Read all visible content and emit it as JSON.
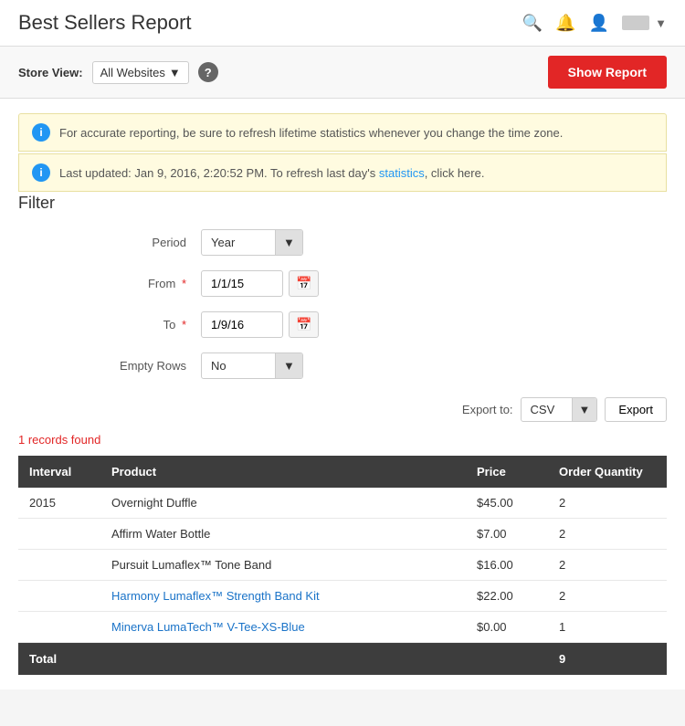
{
  "header": {
    "title": "Best Sellers Report",
    "icons": {
      "search": "&#128269;",
      "bell": "&#128276;",
      "user": "&#128100;"
    }
  },
  "storeViewBar": {
    "label": "Store View:",
    "selected": "All Websites",
    "helpTooltip": "?",
    "showReportBtn": "Show Report"
  },
  "infoBanners": [
    {
      "id": "banner1",
      "text": "For accurate reporting, be sure to refresh lifetime statistics whenever you change the time zone."
    },
    {
      "id": "banner2",
      "textBefore": "Last updated: Jan 9, 2016, 2:20:52 PM. To refresh last day's ",
      "linkText": "statistics",
      "textAfter": ", click here."
    }
  ],
  "filter": {
    "title": "Filter",
    "fields": {
      "period": {
        "label": "Period",
        "value": "Year"
      },
      "from": {
        "label": "From",
        "required": true,
        "value": "1/1/15"
      },
      "to": {
        "label": "To",
        "required": true,
        "value": "1/9/16"
      },
      "emptyRows": {
        "label": "Empty Rows",
        "value": "No"
      }
    }
  },
  "export": {
    "label": "Export to:",
    "format": "CSV",
    "btnLabel": "Export"
  },
  "recordsFound": "1 records found",
  "table": {
    "columns": [
      {
        "id": "interval",
        "label": "Interval"
      },
      {
        "id": "product",
        "label": "Product"
      },
      {
        "id": "price",
        "label": "Price"
      },
      {
        "id": "qty",
        "label": "Order Quantity"
      }
    ],
    "rows": [
      {
        "interval": "2015",
        "product": "Overnight Duffle",
        "price": "$45.00",
        "qty": "2",
        "link": false
      },
      {
        "interval": "",
        "product": "Affirm Water Bottle",
        "price": "$7.00",
        "qty": "2",
        "link": false
      },
      {
        "interval": "",
        "product": "Pursuit Lumaflex™ Tone Band",
        "price": "$16.00",
        "qty": "2",
        "link": false
      },
      {
        "interval": "",
        "product": "Harmony Lumaflex™ Strength Band Kit",
        "price": "$22.00",
        "qty": "2",
        "link": true
      },
      {
        "interval": "",
        "product": "Minerva LumaTech™ V-Tee-XS-Blue",
        "price": "$0.00",
        "qty": "1",
        "link": true
      }
    ],
    "total": {
      "label": "Total",
      "qty": "9"
    }
  }
}
